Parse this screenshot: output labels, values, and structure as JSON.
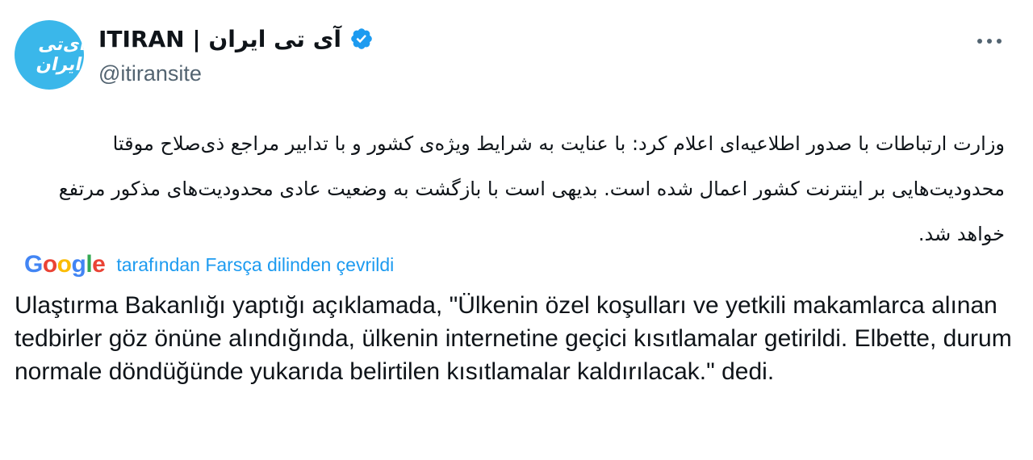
{
  "tweet": {
    "author": {
      "display_name": "ITIRAN | آی تی ایران",
      "handle": "@itiransite",
      "avatar_text": "آی‌تی ایران",
      "verified": true
    },
    "more_icon": "more-horizontal-icon",
    "original_text": "وزارت ارتباطات با صدور اطلاعیه‌ای اعلام کرد: با عنایت به شرایط ویژه‌ی کشور و با تدابیر مراجع ذی‌صلاح موقتا محدودیت‌هایی بر اینترنت کشور اعمال شده است. بدیهی است با بازگشت به وضعیت عادی محدودیت‌های مذکور مرتفع خواهد شد.",
    "translation": {
      "provider_logo": "Google",
      "attribution": "tarafından Farsça dilinden çevrildi",
      "text": "Ulaştırma Bakanlığı yaptığı açıklamada, \"Ülkenin özel koşulları ve yetkili makamlarca alınan tedbirler göz önüne alındığında, ülkenin internetine geçici kısıtlamalar getirildi. Elbette, durum normale döndüğünde yukarıda belirtilen kısıtlamalar kaldırılacak.\" dedi."
    }
  },
  "colors": {
    "avatar_bg": "#3ab7ea",
    "verified_badge": "#1d9bf0",
    "link": "#1d9bf0",
    "secondary_text": "#536471",
    "primary_text": "#0f1419"
  }
}
